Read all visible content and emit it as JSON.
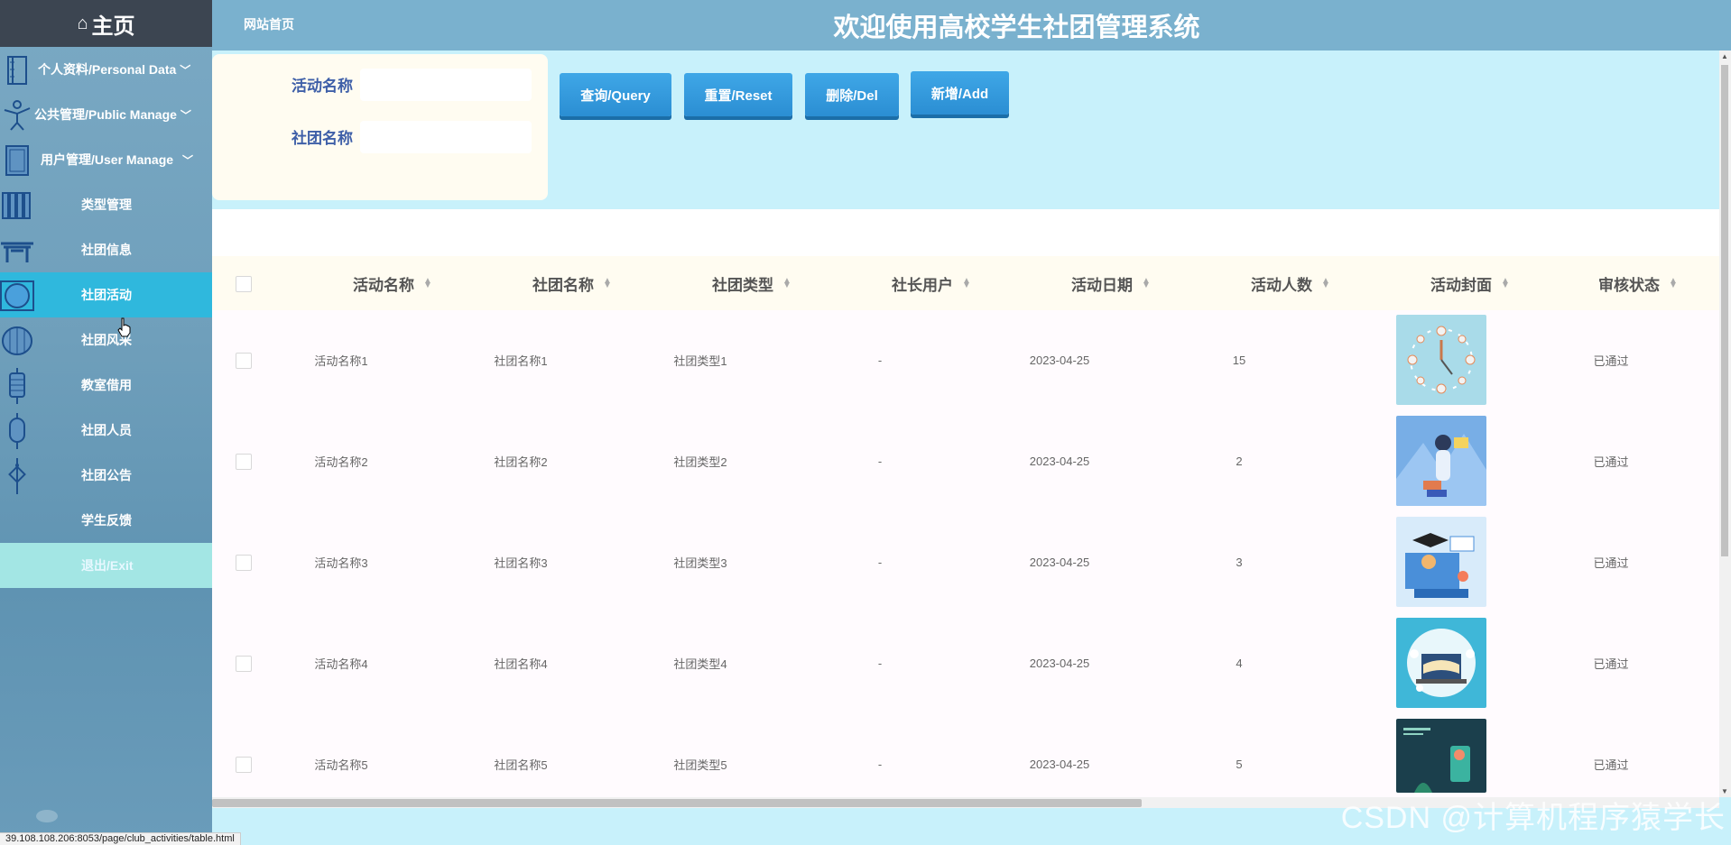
{
  "sidebar": {
    "home_label": "主页",
    "items": [
      {
        "label": "个人资料/Personal Data",
        "icon": "book-icon",
        "expandable": true
      },
      {
        "label": "公共管理/Public Manage",
        "icon": "acrobat-icon",
        "expandable": true
      },
      {
        "label": "用户管理/User Manage",
        "icon": "door-icon",
        "expandable": true
      },
      {
        "label": "类型管理",
        "icon": "bamboo-scroll-icon"
      },
      {
        "label": "社团信息",
        "icon": "archway-icon"
      },
      {
        "label": "社团活动",
        "icon": "round-window-icon",
        "active": true
      },
      {
        "label": "社团风采",
        "icon": "lantern-icon"
      },
      {
        "label": "教室借用",
        "icon": "hanging-lantern-icon"
      },
      {
        "label": "社团人员",
        "icon": "small-lantern-icon"
      },
      {
        "label": "社团公告",
        "icon": "chinese-knot-icon"
      },
      {
        "label": "学生反馈",
        "icon": ""
      },
      {
        "label": "退出/Exit",
        "icon": ""
      }
    ]
  },
  "header": {
    "site_link": "网站首页",
    "title": "欢迎使用高校学生社团管理系统"
  },
  "search": {
    "field1_label": "活动名称",
    "field2_label": "社团名称",
    "buttons": [
      "查询/Query",
      "重置/Reset",
      "删除/Del",
      "新增/Add"
    ]
  },
  "table": {
    "columns": [
      "活动名称",
      "社团名称",
      "社团类型",
      "社长用户",
      "活动日期",
      "活动人数",
      "活动封面",
      "审核状态"
    ],
    "rows": [
      {
        "name": "活动名称1",
        "club": "社团名称1",
        "type": "社团类型1",
        "leader": "-",
        "date": "2023-04-25",
        "count": "15",
        "status": "已通过"
      },
      {
        "name": "活动名称2",
        "club": "社团名称2",
        "type": "社团类型2",
        "leader": "-",
        "date": "2023-04-25",
        "count": "2",
        "status": "已通过"
      },
      {
        "name": "活动名称3",
        "club": "社团名称3",
        "type": "社团类型3",
        "leader": "-",
        "date": "2023-04-25",
        "count": "3",
        "status": "已通过"
      },
      {
        "name": "活动名称4",
        "club": "社团名称4",
        "type": "社团类型4",
        "leader": "-",
        "date": "2023-04-25",
        "count": "4",
        "status": "已通过"
      },
      {
        "name": "活动名称5",
        "club": "社团名称5",
        "type": "社团类型5",
        "leader": "-",
        "date": "2023-04-25",
        "count": "5",
        "status": "已通过"
      }
    ]
  },
  "status_bar_url": "39.108.108.206:8053/page/club_activities/table.html",
  "watermark": "CSDN @计算机程序猿学长",
  "colors": {
    "active_menu": "#2fb8dd",
    "button": "#3fa7e7",
    "label_blue": "#3e5fa8"
  }
}
